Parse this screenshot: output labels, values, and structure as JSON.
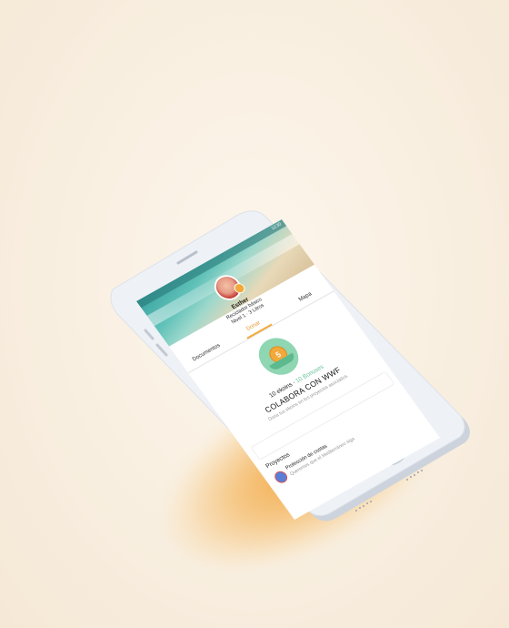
{
  "status": {
    "time": "12:30"
  },
  "profile": {
    "name": "Esther",
    "rank": "Reciclador básico",
    "level": "Nivel 1 · 3 Litros"
  },
  "tabs": [
    {
      "label": "Documentos"
    },
    {
      "label": "Donar"
    },
    {
      "label": "Mapa"
    }
  ],
  "donate": {
    "coin_value": "5",
    "ecoline_amount": "10 ekoins",
    "ecoline_sep": " · ",
    "ecoline_bonus": "10 Bonuses",
    "headline": "COLABORA CON WWF",
    "description": "Dona tus ekoins en los proyectos asociados."
  },
  "projects": {
    "section_title": "Proyectos",
    "items": [
      {
        "title": "Protección de costas",
        "description": "Queremos que el Mediterráneo siga"
      }
    ]
  },
  "colors": {
    "accent": "#f2a93b",
    "green": "#8fd6b2",
    "phone_body": "#e9edf3"
  }
}
